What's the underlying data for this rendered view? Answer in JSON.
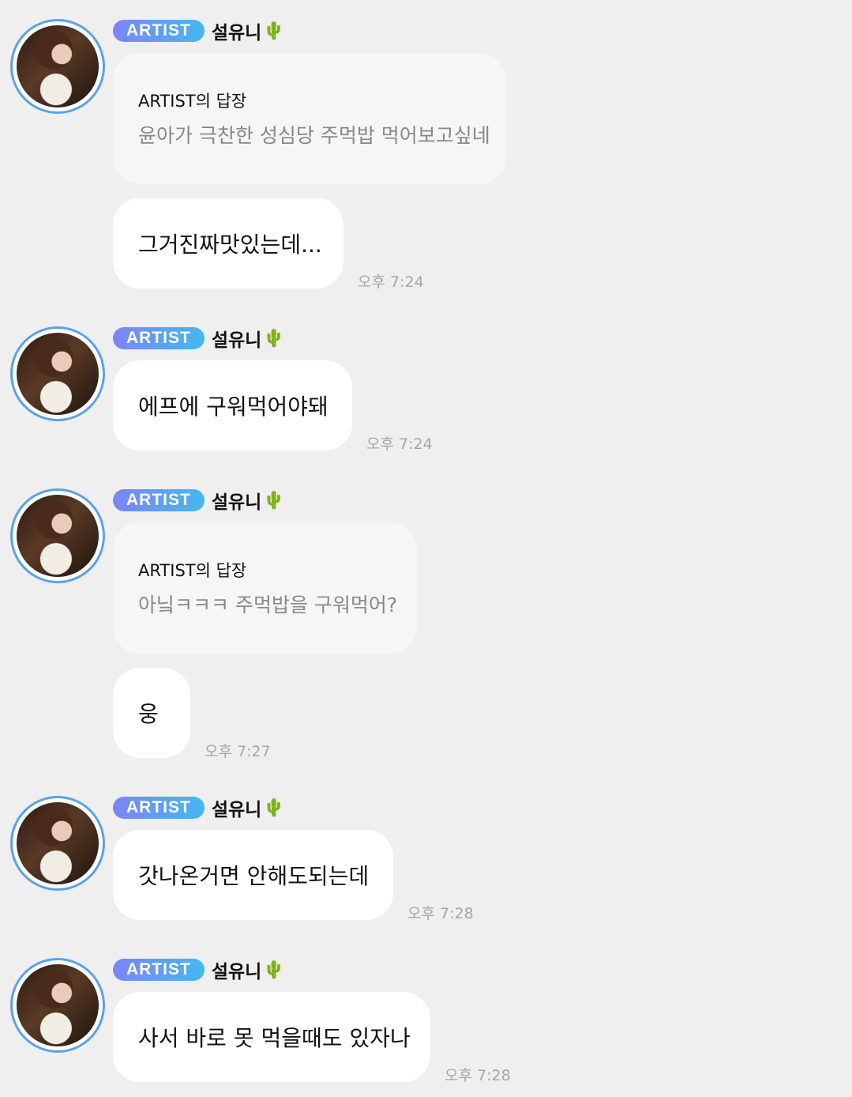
{
  "badge_label": "ARTIST",
  "artist_name": "설유니",
  "name_emoji": "🌵",
  "messages": [
    {
      "reply": {
        "label": "ARTIST의 답장",
        "text": "윤아가 극찬한 성심당 주먹밥 먹어보고싶네"
      },
      "text": "그거진짜맛있는데...",
      "time": "오후 7:24"
    },
    {
      "text": "에프에 구워먹어야돼",
      "time": "오후 7:24"
    },
    {
      "reply": {
        "label": "ARTIST의 답장",
        "text": "아닠ㅋㅋㅋ 주먹밥을 구워먹어?"
      },
      "text": "웅",
      "time": "오후 7:27"
    },
    {
      "text": "갓나온거면 안해도되는데",
      "time": "오후 7:28"
    },
    {
      "text": "사서 바로 못 먹을때도 있자나",
      "time": "오후 7:28"
    }
  ]
}
